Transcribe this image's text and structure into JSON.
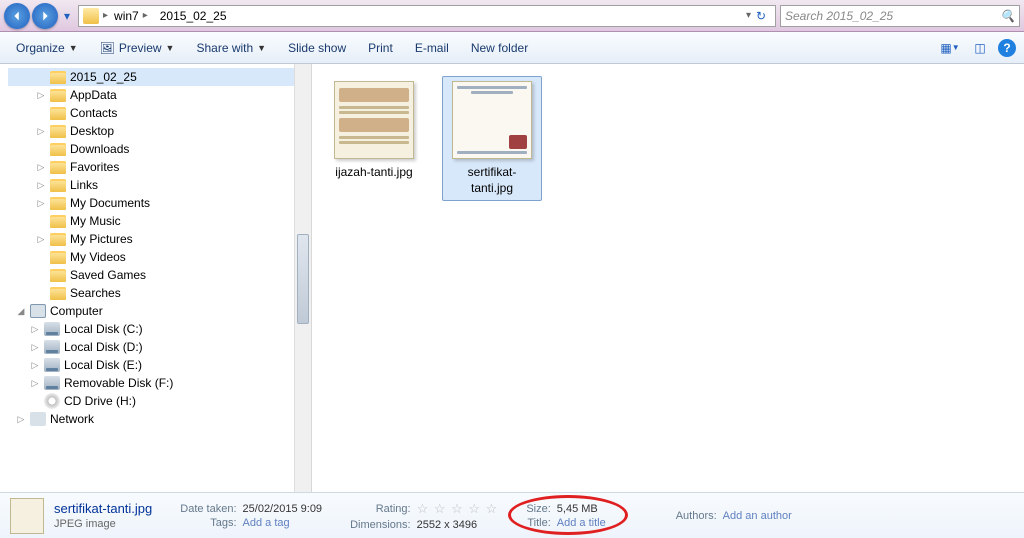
{
  "breadcrumb": {
    "seg1": "win7",
    "seg2": "2015_02_25"
  },
  "search": {
    "placeholder": "Search 2015_02_25"
  },
  "toolbar": {
    "organize": "Organize",
    "preview": "Preview",
    "share": "Share with",
    "slideshow": "Slide show",
    "print": "Print",
    "email": "E-mail",
    "newfolder": "New folder"
  },
  "tree": {
    "n0": "2015_02_25",
    "n1": "AppData",
    "n2": "Contacts",
    "n3": "Desktop",
    "n4": "Downloads",
    "n5": "Favorites",
    "n6": "Links",
    "n7": "My Documents",
    "n8": "My Music",
    "n9": "My Pictures",
    "n10": "My Videos",
    "n11": "Saved Games",
    "n12": "Searches",
    "n13": "Computer",
    "n14": "Local Disk (C:)",
    "n15": "Local Disk (D:)",
    "n16": "Local Disk (E:)",
    "n17": "Removable Disk (F:)",
    "n18": "CD Drive (H:)",
    "n19": "Network"
  },
  "files": {
    "f0": "ijazah-tanti.jpg",
    "f1": "sertifikat-tanti.jpg"
  },
  "details": {
    "filename": "sertifikat-tanti.jpg",
    "filetype": "JPEG image",
    "date_taken_label": "Date taken:",
    "date_taken": "25/02/2015 9:09",
    "tags_label": "Tags:",
    "tags": "Add a tag",
    "rating_label": "Rating:",
    "dimensions_label": "Dimensions:",
    "dimensions": "2552 x 3496",
    "size_label": "Size:",
    "size": "5,45 MB",
    "title_label": "Title:",
    "title": "Add a title",
    "authors_label": "Authors:",
    "authors": "Add an author"
  }
}
